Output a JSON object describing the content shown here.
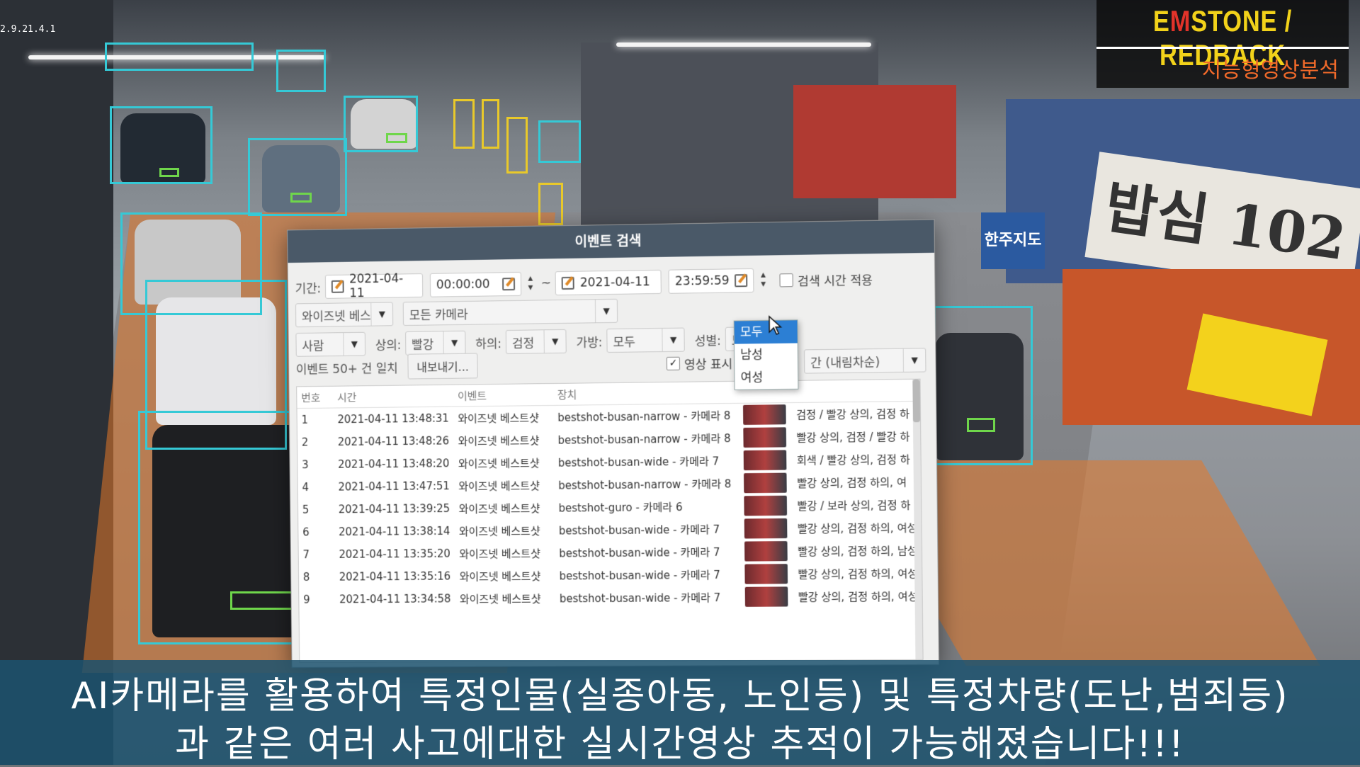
{
  "osd_text": "2.9.21.4.1",
  "brand": {
    "title_prefix": "E",
    "title_m": "M",
    "title_rest": "STONE / REDBACK",
    "subtitle": "지능형영상분석"
  },
  "signs": {
    "shop": "밥심 102",
    "map": "한주지도"
  },
  "dialog": {
    "title": "이벤트 검색",
    "period_label": "기간:",
    "start_date": "2021-04-11",
    "start_time": "00:00:00",
    "range_sep": "~",
    "end_date": "2021-04-11",
    "end_time": "23:59:59",
    "apply_search_time": "검색 시간 적용",
    "event_type": "와이즈넷 베스트샷",
    "camera": "모든 카메라",
    "object": "사람",
    "upper_label": "상의:",
    "upper_value": "빨강",
    "lower_label": "하의:",
    "lower_value": "검정",
    "bag_label": "가방:",
    "bag_value": "모두",
    "gender_label": "성별:",
    "gender_value": "모두",
    "show_video": "영상 표시",
    "sort_partial": "간 (내림차순)",
    "result_count": "이벤트 50+ 건 일치",
    "export_button": "내보내기...",
    "columns": {
      "no": "번호",
      "time": "시간",
      "event": "이벤트",
      "device": "장치"
    },
    "gender_options": [
      "모두",
      "남성",
      "여성"
    ],
    "rows": [
      {
        "no": "1",
        "time": "2021-04-11 13:48:31",
        "event": "와이즈넷 베스트샷",
        "device": "bestshot-busan-narrow - 카메라 8",
        "desc": "검정 / 빨강 상의, 검정 하"
      },
      {
        "no": "2",
        "time": "2021-04-11 13:48:26",
        "event": "와이즈넷 베스트샷",
        "device": "bestshot-busan-narrow - 카메라 8",
        "desc": "빨강 상의, 검정 / 빨강 하"
      },
      {
        "no": "3",
        "time": "2021-04-11 13:48:20",
        "event": "와이즈넷 베스트샷",
        "device": "bestshot-busan-wide - 카메라 7",
        "desc": "회색 / 빨강 상의, 검정 하"
      },
      {
        "no": "4",
        "time": "2021-04-11 13:47:51",
        "event": "와이즈넷 베스트샷",
        "device": "bestshot-busan-narrow - 카메라 8",
        "desc": "빨강 상의, 검정 하의, 여"
      },
      {
        "no": "5",
        "time": "2021-04-11 13:39:25",
        "event": "와이즈넷 베스트샷",
        "device": "bestshot-guro - 카메라 6",
        "desc": "빨강 / 보라 상의, 검정 하"
      },
      {
        "no": "6",
        "time": "2021-04-11 13:38:14",
        "event": "와이즈넷 베스트샷",
        "device": "bestshot-busan-wide - 카메라 7",
        "desc": "빨강 상의, 검정 하의, 여성"
      },
      {
        "no": "7",
        "time": "2021-04-11 13:35:20",
        "event": "와이즈넷 베스트샷",
        "device": "bestshot-busan-wide - 카메라 7",
        "desc": "빨강 상의, 검정 하의, 남성"
      },
      {
        "no": "8",
        "time": "2021-04-11 13:35:16",
        "event": "와이즈넷 베스트샷",
        "device": "bestshot-busan-wide - 카메라 7",
        "desc": "빨강 상의, 검정 하의, 여성"
      },
      {
        "no": "9",
        "time": "2021-04-11 13:34:58",
        "event": "와이즈넷 베스트샷",
        "device": "bestshot-busan-wide - 카메라 7",
        "desc": "빨강 상의, 검정 하의, 여성"
      }
    ]
  },
  "caption": {
    "line1": "AI카메라를 활용하여 특정인물(실종아동, 노인등) 및 특정차량(도난,범죄등)",
    "line2": "과 같은 여러 사고에대한 실시간영상 추적이 가능해졌습니다!!!"
  },
  "colors": {
    "detection": "#35c9d6",
    "person_detection": "#e9c92a",
    "plate": "#6fd64b",
    "brand_yellow": "#f2d21a",
    "brand_red": "#e2332a",
    "caption_bg": "#1c526e"
  }
}
